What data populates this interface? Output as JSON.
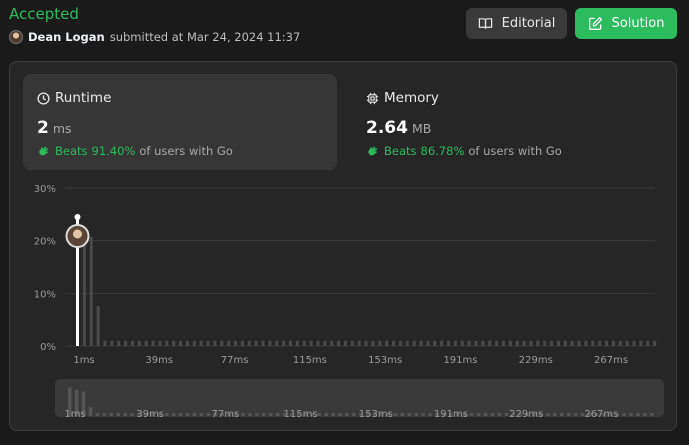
{
  "header": {
    "status": "Accepted",
    "user": "Dean Logan",
    "submitted_text": "submitted at Mar 24, 2024 11:37"
  },
  "buttons": {
    "editorial": "Editorial",
    "solution": "Solution"
  },
  "runtime": {
    "label": "Runtime",
    "value": "2",
    "unit": "ms",
    "beats_label": "Beats",
    "beats_pct": "91.40%",
    "beats_suffix": "of users with Go"
  },
  "memory": {
    "label": "Memory",
    "value": "2.64",
    "unit": "MB",
    "beats_label": "Beats",
    "beats_pct": "86.78%",
    "beats_suffix": "of users with Go"
  },
  "colors": {
    "accent": "#2cbb5d",
    "bar": "#4a4a4a",
    "marker": "#ffffff"
  },
  "chart_data": {
    "type": "bar",
    "title": "",
    "xlabel": "",
    "ylabel": "",
    "ylim": [
      0,
      30
    ],
    "y_ticks": [
      "0%",
      "10%",
      "20%",
      "30%"
    ],
    "x_tick_labels": [
      "1ms",
      "39ms",
      "77ms",
      "115ms",
      "153ms",
      "191ms",
      "229ms",
      "267ms"
    ],
    "selected_category": "2ms",
    "categories": [
      "1ms",
      "2ms",
      "3ms",
      "4ms",
      "5ms",
      "6ms",
      "7ms",
      "8ms",
      "9ms",
      "10ms",
      "11ms",
      "12ms",
      "13ms",
      "14ms",
      "15ms",
      "16ms",
      "17ms",
      "18ms",
      "19ms",
      "20ms",
      "21ms",
      "22ms",
      "23ms",
      "24ms",
      "25ms",
      "26ms",
      "27ms",
      "28ms",
      "29ms",
      "30ms",
      "31ms",
      "32ms",
      "33ms",
      "34ms",
      "35ms",
      "36ms",
      "37ms",
      "38ms",
      "39ms",
      "40ms",
      "41ms",
      "42ms",
      "43ms",
      "44ms",
      "45ms",
      "46ms",
      "47ms",
      "48ms",
      "49ms",
      "50ms",
      "51ms",
      "52ms",
      "53ms",
      "54ms",
      "55ms",
      "56ms",
      "57ms",
      "58ms",
      "59ms",
      "60ms",
      "61ms",
      "62ms",
      "63ms",
      "64ms",
      "65ms",
      "66ms",
      "67ms",
      "68ms",
      "69ms",
      "70ms",
      "71ms",
      "72ms",
      "73ms",
      "74ms",
      "75ms",
      "76ms",
      "77ms",
      "78ms",
      "79ms",
      "80ms",
      "81ms",
      "82ms",
      "83ms",
      "84ms",
      "85ms"
    ],
    "values": [
      24.4,
      22.2,
      20.7,
      7.6,
      1.0,
      1.0,
      1.0,
      1.0,
      1.0,
      1.0,
      1.0,
      1.0,
      1.0,
      1.0,
      1.0,
      1.0,
      1.0,
      1.0,
      1.0,
      1.0,
      1.0,
      1.0,
      1.0,
      1.0,
      1.0,
      1.0,
      1.0,
      1.0,
      1.0,
      1.0,
      1.0,
      1.0,
      1.0,
      1.0,
      1.0,
      1.0,
      1.0,
      1.0,
      1.0,
      1.0,
      1.0,
      1.0,
      1.0,
      1.0,
      1.0,
      1.0,
      1.0,
      1.0,
      1.0,
      1.0,
      1.0,
      1.0,
      1.0,
      1.0,
      1.0,
      1.0,
      1.0,
      1.0,
      1.0,
      1.0,
      1.0,
      1.0,
      1.0,
      1.0,
      1.0,
      1.0,
      1.0,
      1.0,
      1.0,
      1.0,
      1.0,
      1.0,
      1.0,
      1.0,
      1.0,
      1.0,
      1.0,
      1.0,
      1.0,
      1.0,
      1.0,
      1.0,
      1.0,
      1.0,
      1.0
    ]
  }
}
